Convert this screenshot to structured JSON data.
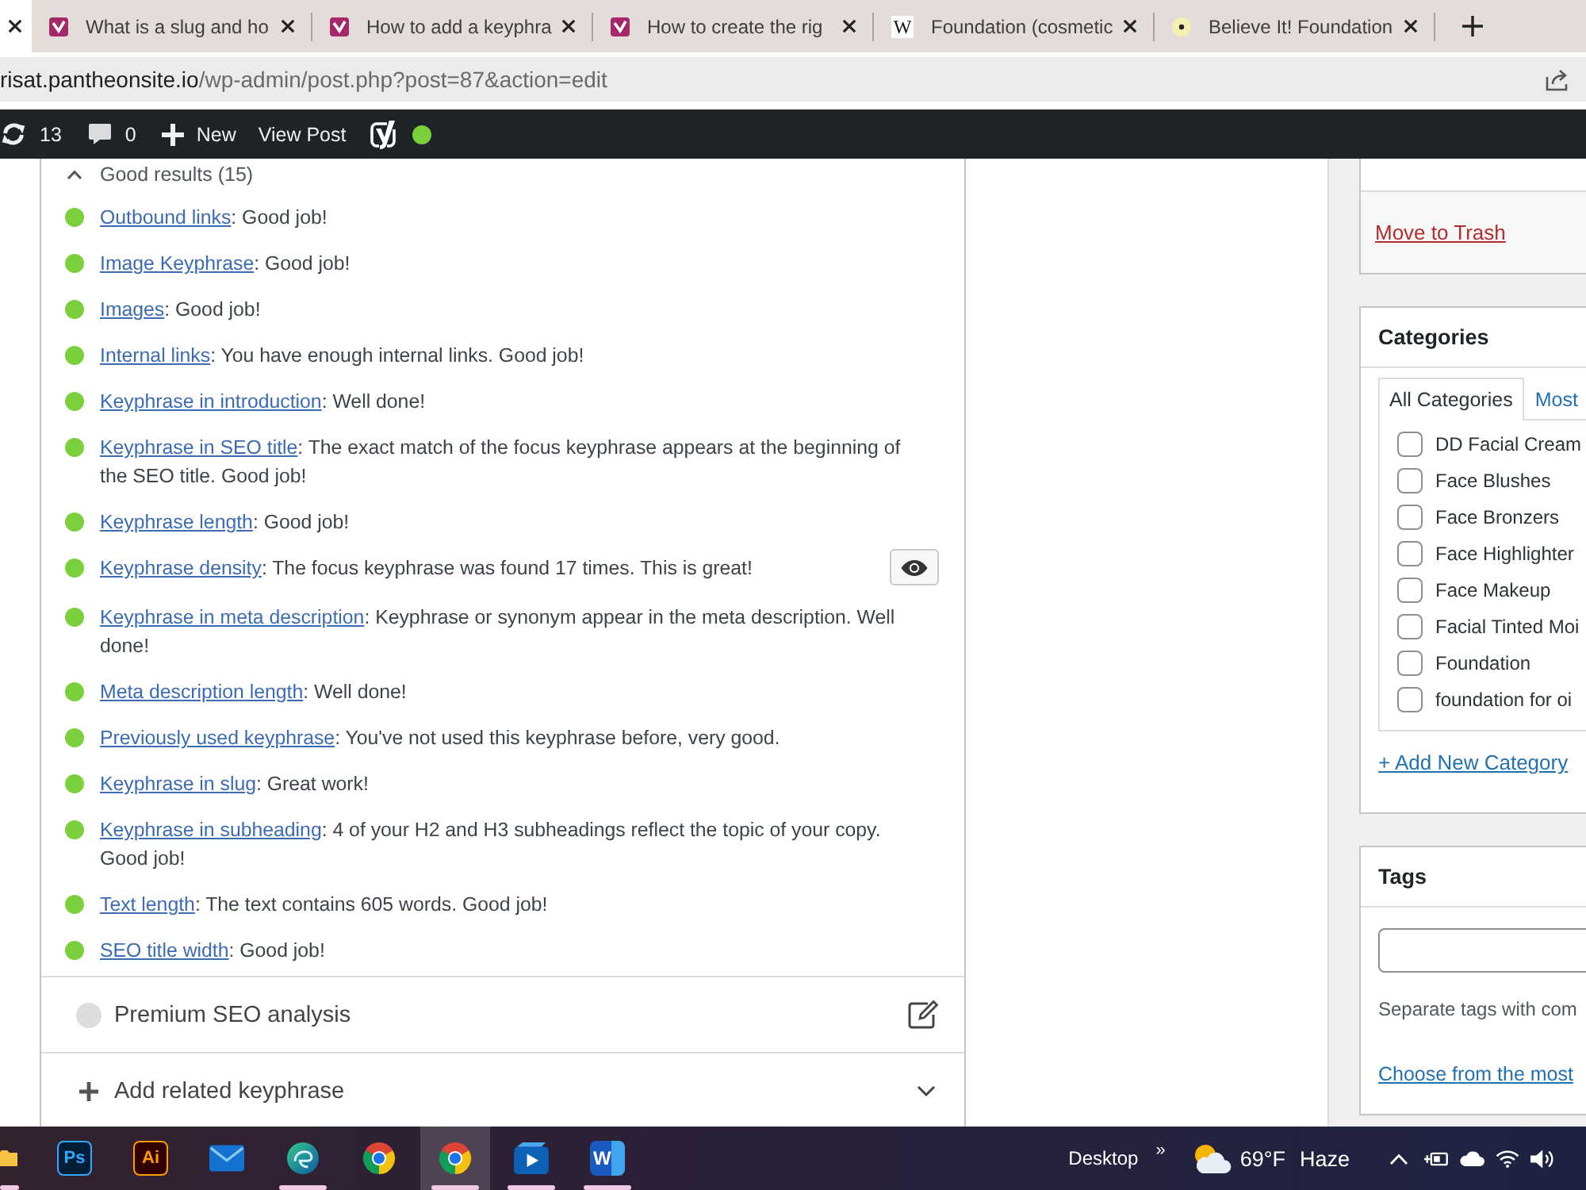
{
  "browser": {
    "tabs": [
      {
        "kind": "stub",
        "selected": true
      },
      {
        "kind": "yoast",
        "title": "What is a slug and ho",
        "selected": false
      },
      {
        "kind": "yoast",
        "title": "How to add a keyphra",
        "selected": false
      },
      {
        "kind": "yoast",
        "title": "How to create the rig",
        "selected": false
      },
      {
        "kind": "letter",
        "favicon_letter": "W",
        "title": "Foundation (cosmetic",
        "selected": false
      },
      {
        "kind": "dot",
        "title": "Believe It! Foundation",
        "selected": false
      }
    ],
    "url": {
      "host": "risat.pantheonsite.io",
      "path": "/wp-admin/post.php?post=87&action=edit"
    }
  },
  "admin_bar": {
    "updates": "13",
    "comments": "0",
    "new": "New",
    "view_post": "View Post",
    "seo_good": true
  },
  "analysis": {
    "heading": "Good results (15)",
    "expanded": true,
    "results": [
      {
        "link": "Outbound links",
        "text": ": Good job!",
        "eye_button": false
      },
      {
        "link": "Image Keyphrase",
        "text": ": Good job!",
        "eye_button": false
      },
      {
        "link": "Images",
        "text": ": Good job!",
        "eye_button": false
      },
      {
        "link": "Internal links",
        "text": ": You have enough internal links. Good job!",
        "eye_button": false
      },
      {
        "link": "Keyphrase in introduction",
        "text": ": Well done!",
        "eye_button": false
      },
      {
        "link": "Keyphrase in SEO title",
        "text": ": The exact match of the focus keyphrase appears at the beginning of the SEO title. Good job!",
        "eye_button": false
      },
      {
        "link": "Keyphrase length",
        "text": ": Good job!",
        "eye_button": false
      },
      {
        "link": "Keyphrase density",
        "text": ": The focus keyphrase was found 17 times. This is great!",
        "eye_button": true
      },
      {
        "link": "Keyphrase in meta description",
        "text": ": Keyphrase or synonym appear in the meta description. Well done!",
        "eye_button": false
      },
      {
        "link": "Meta description length",
        "text": ": Well done!",
        "eye_button": false
      },
      {
        "link": "Previously used keyphrase",
        "text": ": You've not used this keyphrase before, very good.",
        "eye_button": false
      },
      {
        "link": "Keyphrase in slug",
        "text": ": Great work!",
        "eye_button": false
      },
      {
        "link": "Keyphrase in subheading",
        "text": ": 4 of your H2 and H3 subheadings reflect the topic of your copy. Good job!",
        "eye_button": false
      },
      {
        "link": "Text length",
        "text": ": The text contains 605 words. Good job!",
        "eye_button": false
      },
      {
        "link": "SEO title width",
        "text": ": Good job!",
        "eye_button": false
      }
    ],
    "premium": "Premium SEO analysis",
    "related": "Add related keyphrase"
  },
  "sidebar": {
    "publish": {
      "trash": "Move to Trash"
    },
    "categories": {
      "title": "Categories",
      "tabs": [
        {
          "label": "All Categories",
          "selected": true
        },
        {
          "label": "Most",
          "selected": false
        }
      ],
      "items": [
        {
          "label": "DD Facial Cream",
          "checked": false
        },
        {
          "label": "Face Blushes",
          "checked": false
        },
        {
          "label": "Face Bronzers",
          "checked": false
        },
        {
          "label": "Face Highlighter",
          "checked": false
        },
        {
          "label": "Face Makeup",
          "checked": false
        },
        {
          "label": "Facial Tinted Moi",
          "checked": false
        },
        {
          "label": "Foundation",
          "checked": false
        },
        {
          "label": "foundation for oi",
          "checked": false
        }
      ],
      "add_link": "+ Add New Category"
    },
    "tags": {
      "title": "Tags",
      "hint": "Separate tags with com",
      "choose_link": "Choose from the most"
    }
  },
  "taskbar": {
    "apps": [
      {
        "kind": "folder",
        "running": true,
        "selected": false
      },
      {
        "kind": "photoshop",
        "label": "Ps",
        "running": false,
        "selected": false
      },
      {
        "kind": "illustrator",
        "label": "Ai",
        "running": false,
        "selected": false
      },
      {
        "kind": "mail",
        "running": false,
        "selected": false
      },
      {
        "kind": "edge",
        "running": true,
        "selected": false
      },
      {
        "kind": "chrome",
        "running": false,
        "selected": false
      },
      {
        "kind": "chrome",
        "running": true,
        "selected": true
      },
      {
        "kind": "media",
        "running": true,
        "selected": false
      },
      {
        "kind": "word",
        "label": "W",
        "running": true,
        "selected": false
      }
    ],
    "desktop": "Desktop",
    "overflow": "»",
    "weather": {
      "temp": "69°F",
      "condition": "Haze"
    }
  }
}
